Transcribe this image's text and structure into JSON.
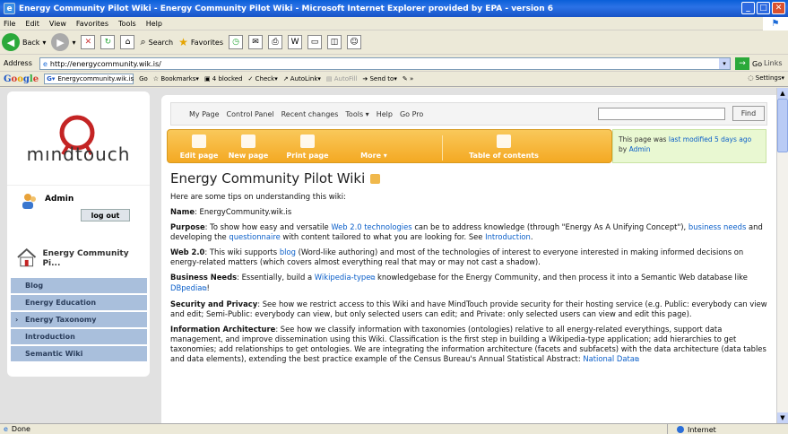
{
  "window": {
    "title": "Energy Community Pilot Wiki - Energy Community Pilot Wiki - Microsoft Internet Explorer provided by EPA - version 6"
  },
  "menu": [
    "File",
    "Edit",
    "View",
    "Favorites",
    "Tools",
    "Help"
  ],
  "toolbar": {
    "back": "Back",
    "search": "Search",
    "favorites": "Favorites"
  },
  "address": {
    "label": "Address",
    "url": "http://energycommunity.wik.is/",
    "go": "Go",
    "links": "Links"
  },
  "google": {
    "logo": "Google",
    "query": "Energycommunity.wik.is",
    "go": "Go",
    "bookmarks": "Bookmarks",
    "blocked": "4 blocked",
    "check": "Check",
    "autolink": "AutoLink",
    "autofill": "AutoFill",
    "sendto": "Send to",
    "settings": "Settings"
  },
  "sidebar": {
    "logo_text": "mındtouch",
    "user": "Admin",
    "logout": "log out",
    "home": "Energy Community Pi...",
    "items": [
      "Blog",
      "Energy Education",
      "Energy Taxonomy",
      "Introduction",
      "Semantic Wiki"
    ]
  },
  "topnav": {
    "items": [
      "My Page",
      "Control Panel",
      "Recent changes",
      "Tools",
      "Help",
      "Go Pro"
    ],
    "tools_caret": "▾",
    "find": "Find"
  },
  "actions": {
    "edit": "Edit page",
    "new": "New page",
    "print": "Print page",
    "more": "More",
    "toc": "Table of contents"
  },
  "lastmod": {
    "pre": "This page was ",
    "link": "last modified 5 days ago",
    "by": " by ",
    "user": "Admin"
  },
  "page": {
    "title": "Energy Community Pilot Wiki",
    "intro": "Here are some tips on understanding this wiki:",
    "name_label": "Name",
    "name_value": ": EnergyCommunity.wik.is",
    "purpose_label": "Purpose",
    "purpose_a": ": To show how easy and versatile ",
    "purpose_link1": "Web 2.0 technologies",
    "purpose_b": " can be to address knowledge (through \"Energy As A Unifying Concept\"), ",
    "purpose_link2": "business needs",
    "purpose_c": " and developing the ",
    "purpose_link3": "questionnaire",
    "purpose_d": " with content tailored to what you are looking for. See ",
    "purpose_link4": "Introduction",
    "purpose_e": ".",
    "web20_label": "Web 2.0",
    "web20_a": ": This wiki supports ",
    "web20_link": "blog",
    "web20_b": " (Word-like authoring) and most of the technologies of interest to everyone interested in making informed decisions on energy-related matters (which covers almost everything real that may or may not cast a shadow).",
    "biz_label": "Business Needs",
    "biz_a": ": Essentially, build a ",
    "biz_link1": "Wikipedia-type",
    "biz_b": " knowledgebase for the Energy Community, and then process it into a Semantic Web database like ",
    "biz_link2": "DBpedia",
    "biz_c": "!",
    "sec_label": "Security and Privacy",
    "sec_text": ": See how we restrict access to this Wiki and have MindTouch provide security for their hosting service (e.g. Public: everybody can view and edit; Semi-Public: everybody can view, but only selected users can edit; and Private: only selected users can view and edit this page).",
    "ia_label": "Information Architecture",
    "ia_text": ": See how we classify information with taxonomies (ontologies) relative to all energy-related everythings, support data management, and improve dissemination using this Wiki. Classification is the first step in building a Wikipedia-type application; add hierarchies to get taxonomies; add relationships to get ontologies. We are integrating the information architecture (facets and subfacets) with the data architecture (data tables and data elements), extending the best practice example of the Census Bureau's Annual Statistical Abstract: ",
    "ia_link": "National Data"
  },
  "status": {
    "left": "Done",
    "zone": "Internet"
  }
}
